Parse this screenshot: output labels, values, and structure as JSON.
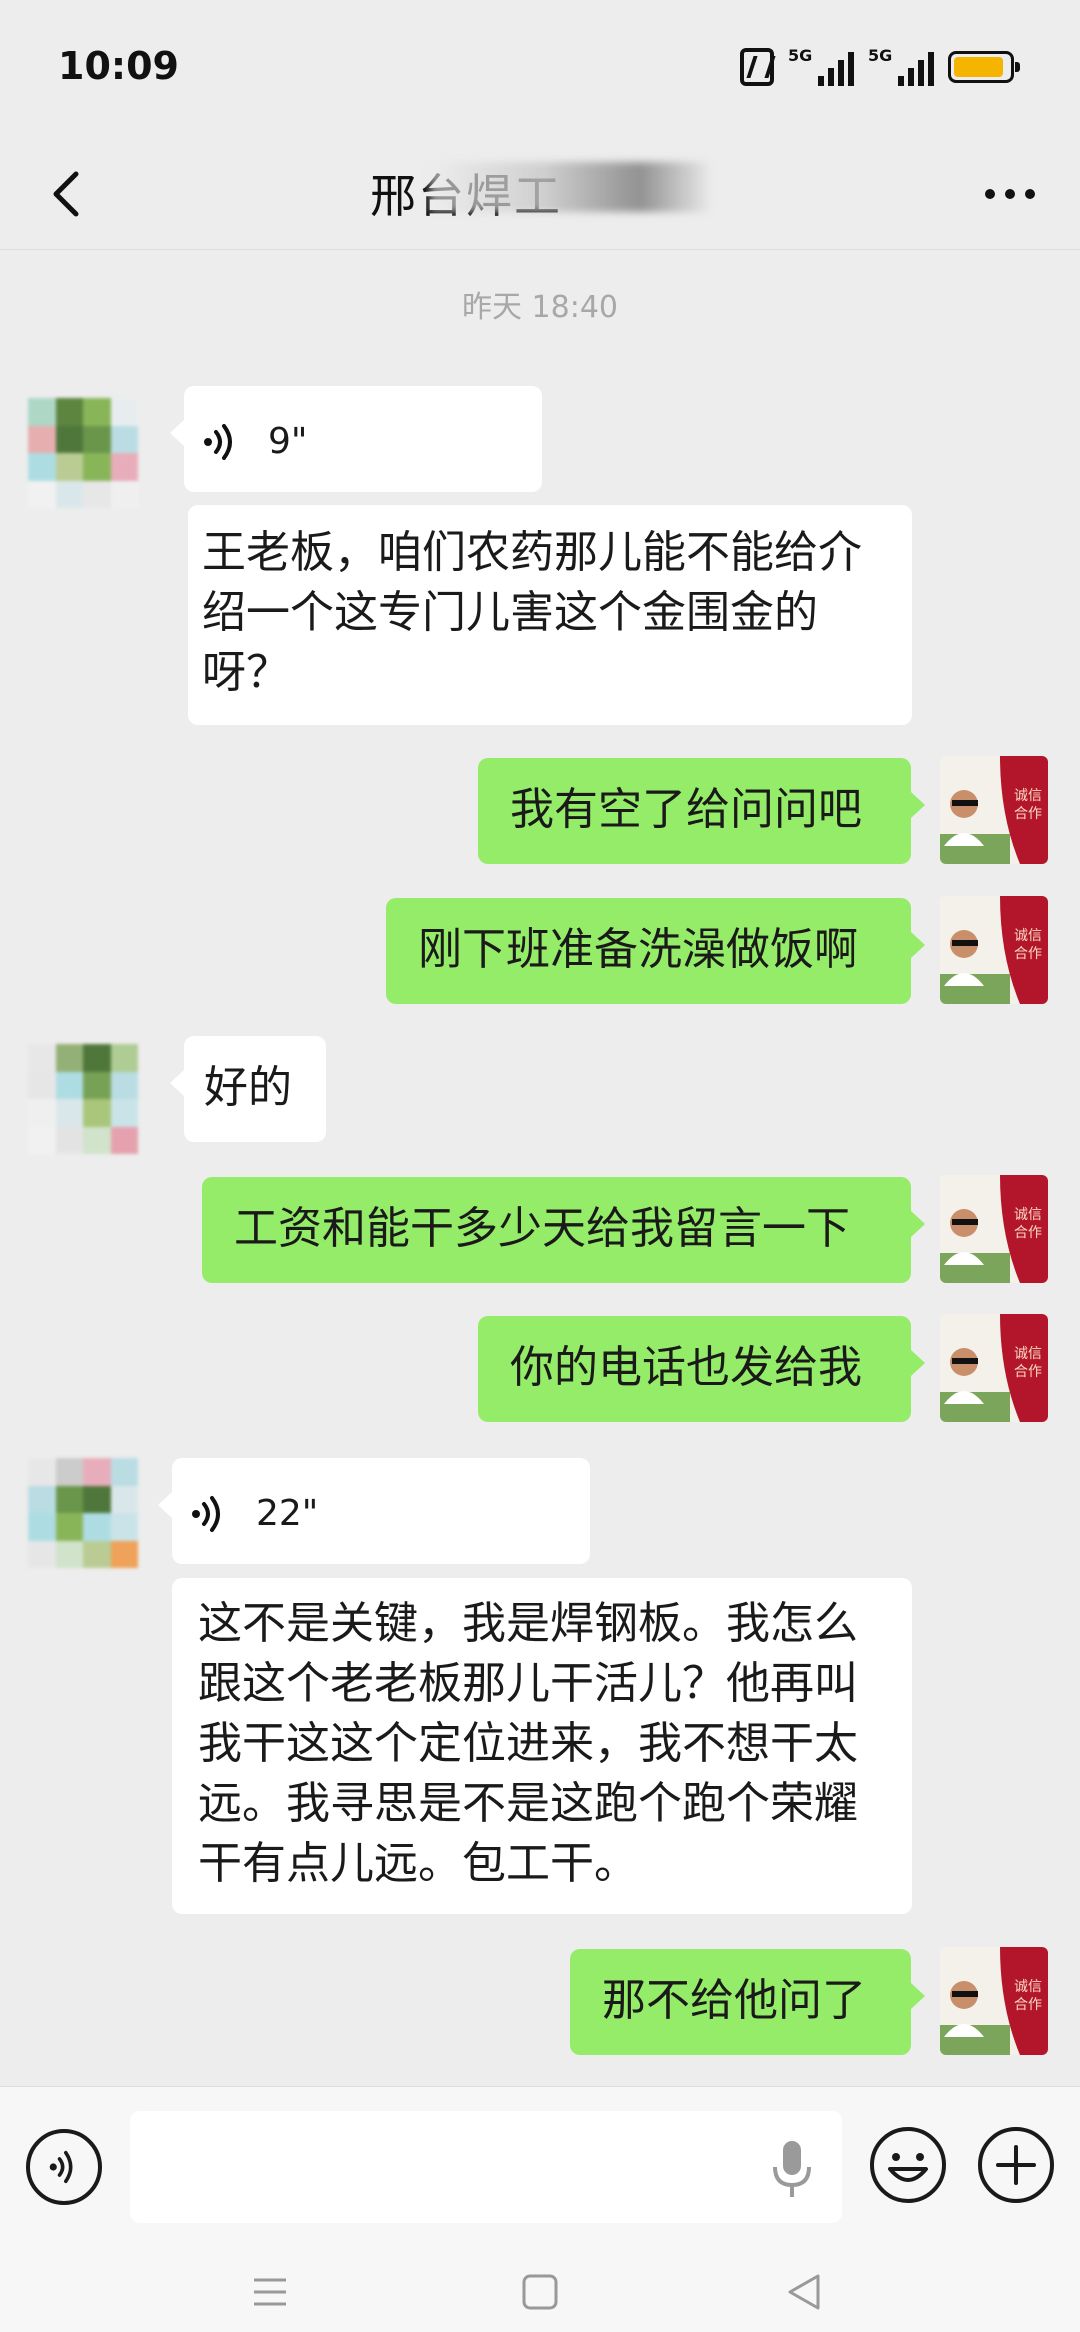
{
  "status_bar": {
    "time": "10:09",
    "signal_1_label": "5G",
    "signal_2_label": "5G",
    "battery_level": 0.9
  },
  "header": {
    "title": "邢台焊工"
  },
  "chat": {
    "timestamp": "昨天 18:40",
    "messages": [
      {
        "from": "other",
        "type": "voice",
        "duration": "9\""
      },
      {
        "from": "other",
        "type": "text",
        "text": "王老板，咱们农药那儿能不能给介绍一个这专门儿害这个金围金的呀？"
      },
      {
        "from": "me",
        "type": "text",
        "text": "我有空了给问问吧"
      },
      {
        "from": "me",
        "type": "text",
        "text": "刚下班准备洗澡做饭啊"
      },
      {
        "from": "other",
        "type": "text",
        "text": "好的"
      },
      {
        "from": "me",
        "type": "text",
        "text": "工资和能干多少天给我留言一下"
      },
      {
        "from": "me",
        "type": "text",
        "text": "你的电话也发给我"
      },
      {
        "from": "other",
        "type": "voice",
        "duration": "22\""
      },
      {
        "from": "other",
        "type": "text",
        "text": "这不是关键，我是焊钢板。我怎么跟这个老老板那儿干活儿？他再叫我干这这个定位进来，我不想干太远。我寻思是不是这跑个跑个荣耀干有点儿远。包工干。"
      },
      {
        "from": "me",
        "type": "text",
        "text": "那不给他问了"
      }
    ],
    "avatar_me_text": "诚信合作"
  },
  "colors": {
    "background": "#ededed",
    "my_bubble": "#95ec69",
    "other_bubble": "#ffffff",
    "timestamp": "#a8a8a8",
    "battery": "#f4b400"
  },
  "icons": [
    "back-icon",
    "more-icon",
    "voice-icon",
    "microphone-icon",
    "emoji-icon",
    "plus-icon",
    "menu-icon",
    "home-icon",
    "back-triangle-icon"
  ]
}
